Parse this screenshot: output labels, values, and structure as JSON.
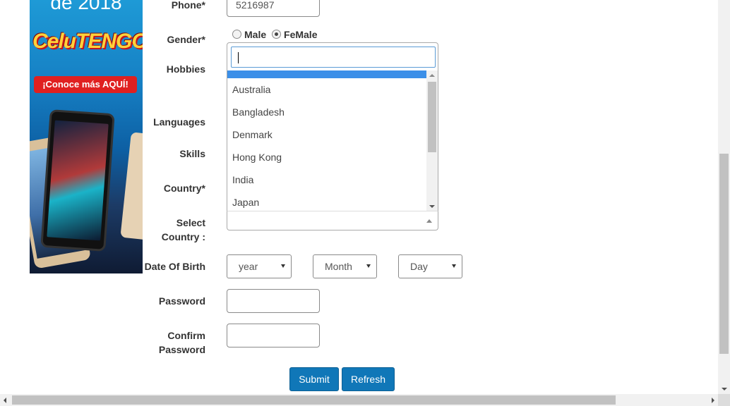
{
  "ad": {
    "year_text": "de 2018",
    "logo_text": "CeluTENGO",
    "cta_text": "¡Conoce más AQUÍ!"
  },
  "form": {
    "phone": {
      "label": "Phone*",
      "value": "5216987"
    },
    "gender": {
      "label": "Gender*",
      "options": [
        "Male",
        "FeMale"
      ],
      "selected": "FeMale"
    },
    "hobbies": {
      "label": "Hobbies"
    },
    "languages": {
      "label": "Languages"
    },
    "skills": {
      "label": "Skills"
    },
    "country": {
      "label": "Country*"
    },
    "select_country": {
      "label_line1": "Select",
      "label_line2": "Country :",
      "search_value": "",
      "options": [
        "Australia",
        "Bangladesh",
        "Denmark",
        "Hong Kong",
        "India",
        "Japan"
      ]
    },
    "dob": {
      "label": "Date Of Birth",
      "year": "year",
      "month": "Month",
      "day": "Day"
    },
    "password": {
      "label": "Password"
    },
    "confirm_password": {
      "label_line1": "Confirm",
      "label_line2": "Password"
    },
    "submit_label": "Submit",
    "refresh_label": "Refresh"
  },
  "colors": {
    "button_bg": "#1077b8",
    "highlight": "#3b8fe8",
    "search_border": "#5b9bd5"
  }
}
